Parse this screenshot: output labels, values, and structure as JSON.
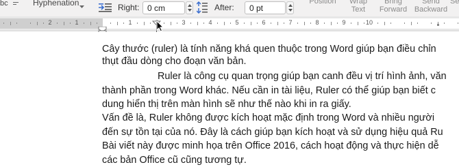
{
  "ribbon": {
    "hyphenation_label": "Hyphenation",
    "partial_left_label": "bc",
    "indent_right_label": "Right:",
    "indent_right_value": "0 cm",
    "spacing_after_label": "After:",
    "spacing_after_value": "0 pt",
    "position_label": "Position",
    "wrap_text_label": [
      "Wrap",
      "Text"
    ],
    "bring_forward_label": [
      "Bring",
      "Forward"
    ],
    "send_backward_label": [
      "Send",
      "Backward"
    ],
    "partial_right_label": "Se"
  },
  "ruler": {
    "numbers": [
      "2",
      "1",
      "",
      "1",
      "2",
      "3",
      "4",
      "5",
      "6",
      "7",
      "8",
      "9",
      "10"
    ]
  },
  "document": {
    "lines": [
      "Cây thước (ruler) là tính năng khá quen thuộc trong Word giúp bạn điều chỉn",
      "thụt đầu dòng cho đoạn văn bản.",
      "Ruler là công cụ quan trọng giúp bạn canh đều vị trí hình ảnh, văn",
      "thành phần trong Word khác. Nếu cần in tài liệu, Ruler có thể giúp bạn biết c",
      "dung hiển thị trên màn hình sẽ như thế nào khi in ra giấy.",
      "Vấn đề là, Ruler không được kích hoạt mặc định trong Word và nhiều người",
      "đến sự tồn tại của nó. Đây là cách giúp bạn kích hoạt và sử dụng hiệu quả Ru",
      "Bài viết này được minh họa trên Office 2016, cách hoạt động và thực hiện dễ",
      "các bản Office cũ cũng tương tự."
    ]
  }
}
